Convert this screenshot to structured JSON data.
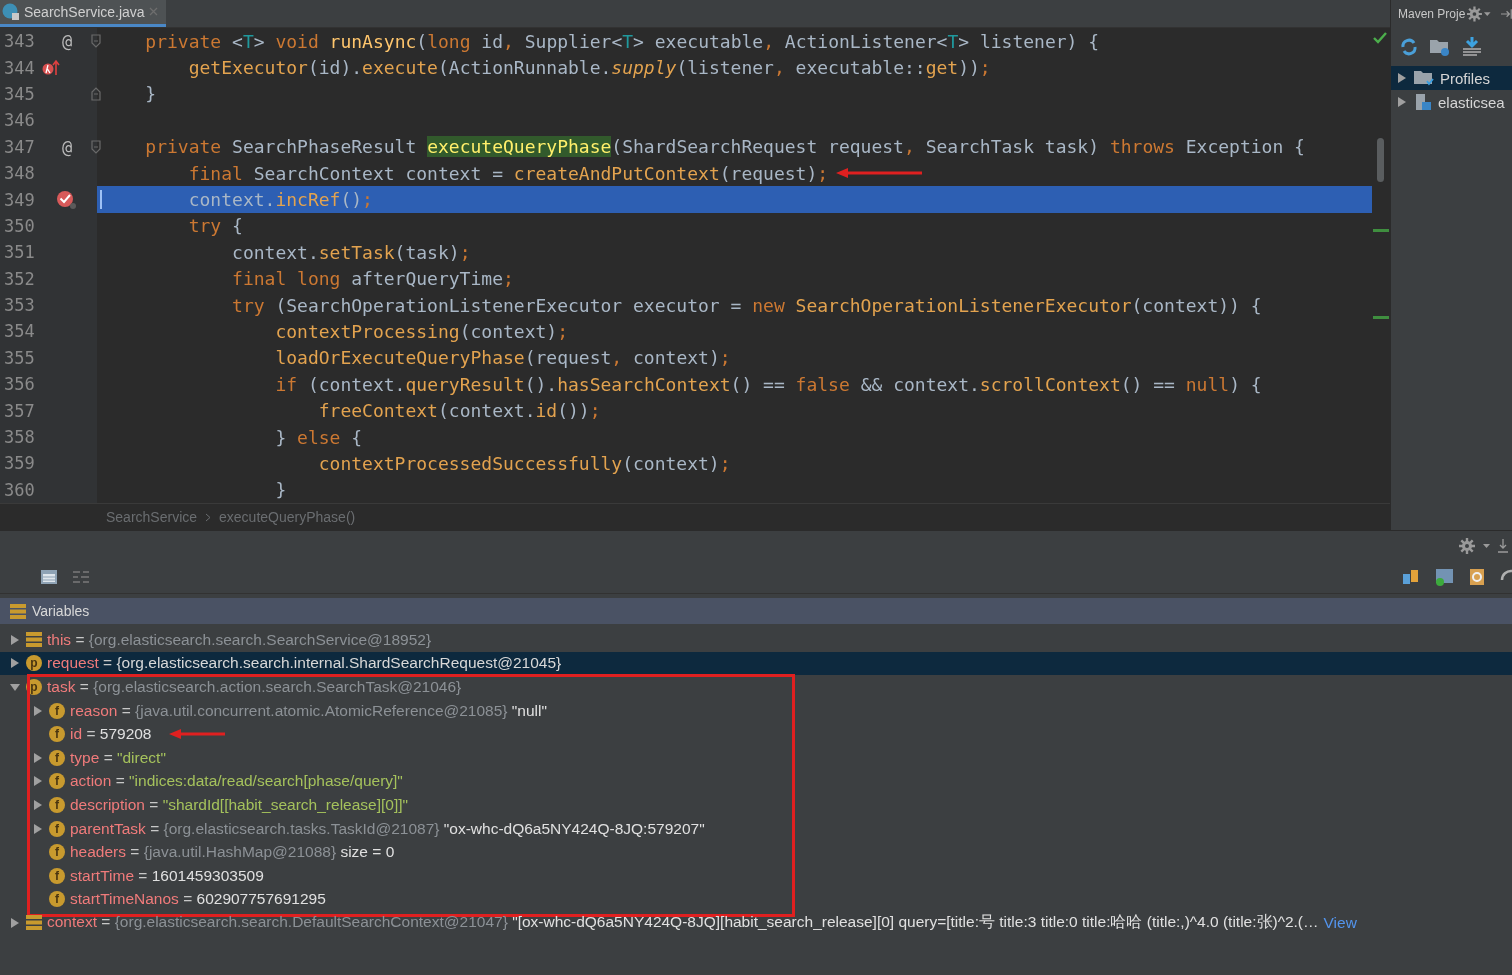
{
  "editor": {
    "tab": {
      "title": "SearchService.java",
      "selected": true
    },
    "lines": [
      {
        "number": "343",
        "gutter": "@",
        "fold_start": true,
        "code": [
          {
            "kind": "kw",
            "text": "    private "
          },
          {
            "kind": "plain",
            "text": "<"
          },
          {
            "kind": "tparam",
            "text": "T"
          },
          {
            "kind": "plain",
            "text": "> "
          },
          {
            "kind": "kw",
            "text": "void "
          },
          {
            "kind": "decl",
            "text": "runAsync"
          },
          {
            "kind": "plain",
            "text": "("
          },
          {
            "kind": "kw",
            "text": "long "
          },
          {
            "kind": "plain",
            "text": "id"
          },
          {
            "kind": "kw",
            "text": ", "
          },
          {
            "kind": "plain",
            "text": "Supplier<"
          },
          {
            "kind": "tparam",
            "text": "T"
          },
          {
            "kind": "plain",
            "text": "> executable"
          },
          {
            "kind": "kw",
            "text": ", "
          },
          {
            "kind": "plain",
            "text": "ActionListener<"
          },
          {
            "kind": "tparam",
            "text": "T"
          },
          {
            "kind": "plain",
            "text": "> listener) {"
          }
        ]
      },
      {
        "number": "344",
        "lambda_breakpoint": true,
        "code": [
          {
            "kind": "call",
            "text": "        getExecutor"
          },
          {
            "kind": "plain",
            "text": "(id)."
          },
          {
            "kind": "call",
            "text": "execute"
          },
          {
            "kind": "plain",
            "text": "(ActionRunnable."
          },
          {
            "kind": "static",
            "text": "supply"
          },
          {
            "kind": "plain",
            "text": "(listener"
          },
          {
            "kind": "kw",
            "text": ", "
          },
          {
            "kind": "plain",
            "text": "executable::"
          },
          {
            "kind": "call",
            "text": "get"
          },
          {
            "kind": "plain",
            "text": "))"
          },
          {
            "kind": "kw",
            "text": ";"
          }
        ]
      },
      {
        "number": "345",
        "fold_end": true,
        "code": [
          {
            "kind": "plain",
            "text": "    }"
          }
        ]
      },
      {
        "number": "346"
      },
      {
        "number": "347",
        "gutter": "@",
        "fold_start": true,
        "code": [
          {
            "kind": "kw",
            "text": "    private "
          },
          {
            "kind": "plain",
            "text": "SearchPhaseResult "
          },
          {
            "kind": "found",
            "text": "executeQueryPhase"
          },
          {
            "kind": "plain",
            "text": "(ShardSearchRequest request"
          },
          {
            "kind": "kw",
            "text": ", "
          },
          {
            "kind": "plain",
            "text": "SearchTask task) "
          },
          {
            "kind": "kw",
            "text": "throws "
          },
          {
            "kind": "plain",
            "text": "Exception {"
          }
        ]
      },
      {
        "number": "348",
        "annotated": true,
        "code": [
          {
            "kind": "kw",
            "text": "        final "
          },
          {
            "kind": "plain",
            "text": "SearchContext context = "
          },
          {
            "kind": "call",
            "text": "createAndPutContext"
          },
          {
            "kind": "plain",
            "text": "(request)"
          },
          {
            "kind": "kw",
            "text": ";"
          }
        ]
      },
      {
        "number": "349",
        "breakpoint": true,
        "current": true,
        "code": [
          {
            "kind": "plain",
            "text": "        context."
          },
          {
            "kind": "call",
            "text": "incRef"
          },
          {
            "kind": "plain",
            "text": "()"
          },
          {
            "kind": "kw",
            "text": ";"
          }
        ]
      },
      {
        "number": "350",
        "code": [
          {
            "kind": "kw",
            "text": "        try "
          },
          {
            "kind": "plain",
            "text": "{"
          }
        ]
      },
      {
        "number": "351",
        "code": [
          {
            "kind": "plain",
            "text": "            context."
          },
          {
            "kind": "call",
            "text": "setTask"
          },
          {
            "kind": "plain",
            "text": "(task)"
          },
          {
            "kind": "kw",
            "text": ";"
          }
        ]
      },
      {
        "number": "352",
        "code": [
          {
            "kind": "kw",
            "text": "            final long "
          },
          {
            "kind": "plain",
            "text": "afterQueryTime"
          },
          {
            "kind": "kw",
            "text": ";"
          }
        ]
      },
      {
        "number": "353",
        "code": [
          {
            "kind": "kw",
            "text": "            try "
          },
          {
            "kind": "plain",
            "text": "(SearchOperationListenerExecutor executor = "
          },
          {
            "kind": "kw",
            "text": "new "
          },
          {
            "kind": "call",
            "text": "SearchOperationListenerExecutor"
          },
          {
            "kind": "plain",
            "text": "(context)) {"
          }
        ]
      },
      {
        "number": "354",
        "code": [
          {
            "kind": "call",
            "text": "                contextProcessing"
          },
          {
            "kind": "plain",
            "text": "(context)"
          },
          {
            "kind": "kw",
            "text": ";"
          }
        ]
      },
      {
        "number": "355",
        "code": [
          {
            "kind": "call",
            "text": "                loadOrExecuteQueryPhase"
          },
          {
            "kind": "plain",
            "text": "(request"
          },
          {
            "kind": "kw",
            "text": ", "
          },
          {
            "kind": "plain",
            "text": "context)"
          },
          {
            "kind": "kw",
            "text": ";"
          }
        ]
      },
      {
        "number": "356",
        "code": [
          {
            "kind": "kw",
            "text": "                if "
          },
          {
            "kind": "plain",
            "text": "(context."
          },
          {
            "kind": "call",
            "text": "queryResult"
          },
          {
            "kind": "plain",
            "text": "()."
          },
          {
            "kind": "call",
            "text": "hasSearchContext"
          },
          {
            "kind": "plain",
            "text": "() == "
          },
          {
            "kind": "kw",
            "text": "false "
          },
          {
            "kind": "plain",
            "text": "&& context."
          },
          {
            "kind": "call",
            "text": "scrollContext"
          },
          {
            "kind": "plain",
            "text": "() == "
          },
          {
            "kind": "kw",
            "text": "null"
          },
          {
            "kind": "plain",
            "text": ") {"
          }
        ]
      },
      {
        "number": "357",
        "code": [
          {
            "kind": "call",
            "text": "                    freeContext"
          },
          {
            "kind": "plain",
            "text": "(context."
          },
          {
            "kind": "call",
            "text": "id"
          },
          {
            "kind": "plain",
            "text": "())"
          },
          {
            "kind": "kw",
            "text": ";"
          }
        ]
      },
      {
        "number": "358",
        "code": [
          {
            "kind": "plain",
            "text": "                } "
          },
          {
            "kind": "kw",
            "text": "else "
          },
          {
            "kind": "plain",
            "text": "{"
          }
        ]
      },
      {
        "number": "359",
        "code": [
          {
            "kind": "call",
            "text": "                    contextProcessedSuccessfully"
          },
          {
            "kind": "plain",
            "text": "(context)"
          },
          {
            "kind": "kw",
            "text": ";"
          }
        ]
      },
      {
        "number": "360",
        "code": [
          {
            "kind": "plain",
            "text": "                }"
          }
        ]
      }
    ],
    "breadcrumb": [
      "SearchService",
      "executeQueryPhase()"
    ]
  },
  "maven_panel": {
    "title": "Maven Proje",
    "tree": [
      {
        "kind": "profiles",
        "label": "Profiles",
        "selected": true
      },
      {
        "kind": "module",
        "label": "elasticsea",
        "selected": false
      }
    ]
  },
  "debugger": {
    "variables_title": "Variables",
    "variables": [
      {
        "kind": "local",
        "name": "this",
        "eq": "=",
        "ref": "{org.elasticsearch.search.SearchService@18952}",
        "expandable": true,
        "expanded": false,
        "selected": false
      },
      {
        "kind": "param",
        "badge": "p",
        "name": "request",
        "eq": "=",
        "ref": "{org.elasticsearch.search.internal.ShardSearchRequest@21045}",
        "expandable": true,
        "expanded": false,
        "selected": true
      },
      {
        "kind": "param",
        "badge": "p",
        "name": "task",
        "eq": "=",
        "ref": "{org.elasticsearch.action.search.SearchTask@21046}",
        "expandable": true,
        "expanded": true,
        "selected": false,
        "outlined": true,
        "children": [
          {
            "kind": "field",
            "badge": "f",
            "name": "reason",
            "eq": "=",
            "ref": "{java.util.concurrent.atomic.AtomicReference@21085}",
            "value": "\"null\"",
            "string": false,
            "expandable": true,
            "expanded": false,
            "selected": false
          },
          {
            "kind": "field",
            "badge": "f",
            "name": "id",
            "eq": "=",
            "value": "579208",
            "string": false,
            "expandable": false,
            "selected": false,
            "annotated": true
          },
          {
            "kind": "field",
            "badge": "f",
            "name": "type",
            "eq": "=",
            "value": "\"direct\"",
            "string": true,
            "expandable": true,
            "expanded": false,
            "selected": false
          },
          {
            "kind": "field",
            "badge": "f",
            "name": "action",
            "eq": "=",
            "value": "\"indices:data/read/search[phase/query]\"",
            "string": true,
            "expandable": true,
            "expanded": false,
            "selected": false
          },
          {
            "kind": "field",
            "badge": "f",
            "name": "description",
            "eq": "=",
            "value": "\"shardId[[habit_search_release][0]]\"",
            "string": true,
            "expandable": true,
            "expanded": false,
            "selected": false
          },
          {
            "kind": "field",
            "badge": "f",
            "name": "parentTask",
            "eq": "=",
            "ref": "{org.elasticsearch.tasks.TaskId@21087}",
            "value": "\"ox-whc-dQ6a5NY424Q-8JQ:579207\"",
            "string": false,
            "expandable": true,
            "expanded": false,
            "selected": false
          },
          {
            "kind": "field",
            "badge": "f",
            "name": "headers",
            "eq": "=",
            "ref": "{java.util.HashMap@21088}",
            "value": "size = 0",
            "string": false,
            "expandable": false,
            "selected": false
          },
          {
            "kind": "field",
            "badge": "f",
            "name": "startTime",
            "eq": "=",
            "value": "1601459303509",
            "string": false,
            "expandable": false,
            "selected": false
          },
          {
            "kind": "field",
            "badge": "f",
            "name": "startTimeNanos",
            "eq": "=",
            "value": "602907757691295",
            "string": false,
            "expandable": false,
            "selected": false
          }
        ]
      },
      {
        "kind": "local",
        "name": "context",
        "eq": "=",
        "ref": "{org.elasticsearch.search.DefaultSearchContext@21047}",
        "value": "\"[ox-whc-dQ6a5NY424Q-8JQ][habit_search_release][0] query=[title:号 title:3 title:0 title:哈哈 (title:,)^4.0 (title:张)^2.(…",
        "string": false,
        "link": "View",
        "expandable": true,
        "expanded": false,
        "selected": false
      }
    ]
  }
}
